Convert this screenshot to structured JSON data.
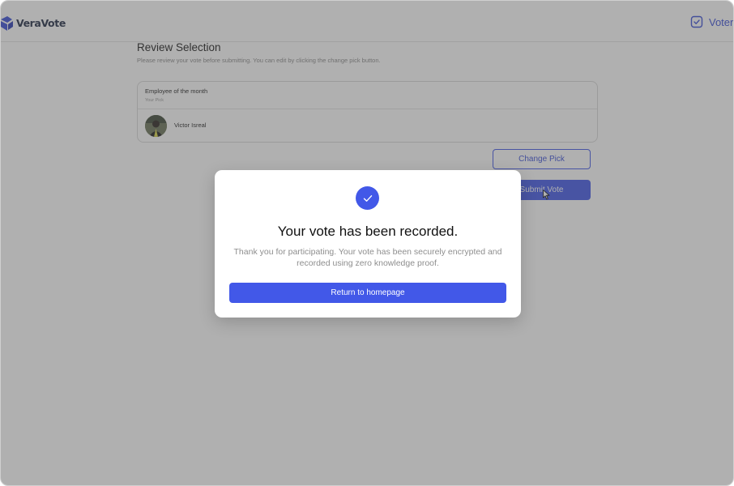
{
  "app": {
    "brand_name": "VeraVote",
    "voter_label": "Voter"
  },
  "review": {
    "title": "Review Selection",
    "subtitle": "Please review your vote before submitting. You can edit by clicking the change pick button.",
    "category": "Employee of the month",
    "pick_label": "Your Pick",
    "candidate_name": "Victor Isreal",
    "change_pick_label": "Change Pick",
    "submit_label": "Submit Vote"
  },
  "modal": {
    "icon": "check-icon",
    "title": "Your vote has been recorded.",
    "message": "Thank you for participating. Your vote has been securely encrypted and recorded using zero knowledge proof.",
    "button_label": "Return to homepage"
  },
  "colors": {
    "accent": "#4258e8",
    "overlay": "rgba(80,80,80,0.45)"
  }
}
